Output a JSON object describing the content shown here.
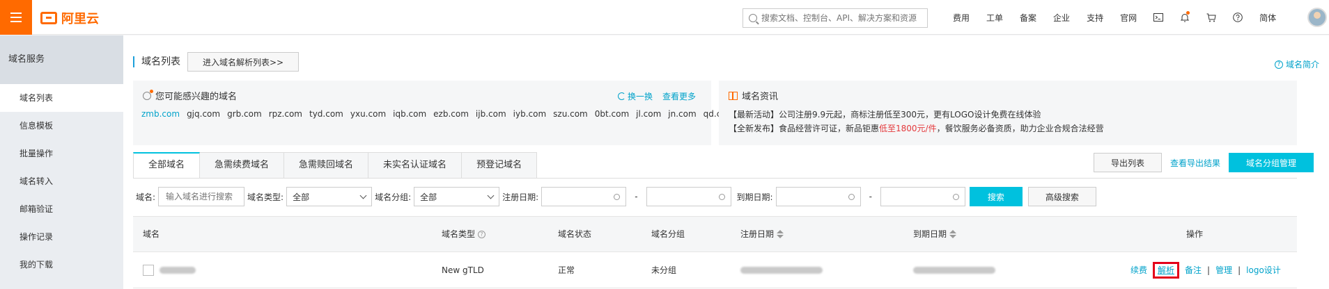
{
  "header": {
    "logo_text": "阿里云",
    "search_placeholder": "搜索文档、控制台、API、解决方案和资源",
    "nav_items": [
      "费用",
      "工单",
      "备案",
      "企业",
      "支持",
      "官网"
    ],
    "language": "简体",
    "notification_dot_color": "#ff6a00"
  },
  "sidebar": {
    "title": "域名服务",
    "items": [
      {
        "label": "域名列表",
        "active": true
      },
      {
        "label": "信息模板",
        "active": false
      },
      {
        "label": "批量操作",
        "active": false
      },
      {
        "label": "域名转入",
        "active": false
      },
      {
        "label": "邮箱验证",
        "active": false
      },
      {
        "label": "操作记录",
        "active": false
      },
      {
        "label": "我的下载",
        "active": false
      }
    ]
  },
  "page": {
    "title": "域名列表",
    "enter_dns_button": "进入域名解析列表>>",
    "help_link": "域名简介"
  },
  "suggest": {
    "title": "您可能感兴趣的域名",
    "refresh_label": "换一换",
    "more_label": "查看更多",
    "domains": [
      "zmb.com",
      "gjq.com",
      "grb.com",
      "rpz.com",
      "tyd.com",
      "yxu.com",
      "iqb.com",
      "ezb.com",
      "ijb.com",
      "iyb.com",
      "szu.com",
      "0bt.com",
      "jl.com",
      "jn.com",
      "qd.com"
    ]
  },
  "news": {
    "title": "域名资讯",
    "line1": "【最新活动】公司注册9.9元起，商标注册低至300元，更有LOGO设计免费在线体验",
    "line2_a": "【全新发布】食品经营许可证，新品钜惠",
    "line2_red": "低至1800元/件",
    "line2_b": "，餐饮服务必备资质，助力企业合规合法经营"
  },
  "tabs": [
    "全部域名",
    "急需续费域名",
    "急需赎回域名",
    "未实名认证域名",
    "预登记域名"
  ],
  "tools": {
    "export_button": "导出列表",
    "view_export_link": "查看导出结果",
    "group_manage_button": "域名分组管理"
  },
  "filter": {
    "domain_label": "域名:",
    "domain_placeholder": "输入域名进行搜索",
    "type_label": "域名类型:",
    "type_value": "全部",
    "group_label": "域名分组:",
    "group_value": "全部",
    "reg_date_label": "注册日期:",
    "expire_date_label": "到期日期:",
    "dash": "-",
    "search_button": "搜索",
    "advanced_button": "高级搜索"
  },
  "table": {
    "headers": {
      "domain": "域名",
      "type": "域名类型",
      "status": "域名状态",
      "group": "域名分组",
      "reg_date": "注册日期",
      "expire_date": "到期日期",
      "ops": "操作"
    },
    "rows": [
      {
        "type": "New gTLD",
        "status": "正常",
        "group": "未分组",
        "ops": [
          "续费",
          "解析",
          "备注",
          "管理",
          "logo设计"
        ]
      }
    ]
  },
  "colors": {
    "brand_orange": "#ff6a00",
    "accent_cyan": "#00c1de",
    "link_blue": "#00a2ca",
    "highlight_red": "#e4001a"
  }
}
